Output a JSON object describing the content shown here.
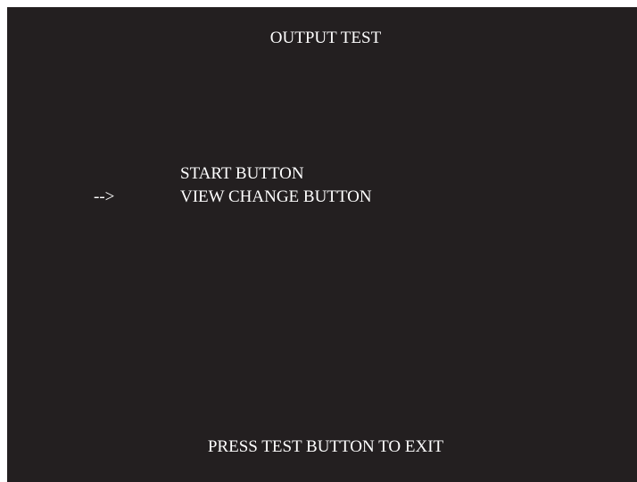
{
  "screen": {
    "title": "OUTPUT TEST",
    "cursor": "-->",
    "menu_items": [
      {
        "label": "START BUTTON",
        "selected": false
      },
      {
        "label": "VIEW CHANGE BUTTON",
        "selected": true
      }
    ],
    "footer": "PRESS TEST BUTTON TO EXIT"
  },
  "colors": {
    "background": "#231f20",
    "text": "#ffffff"
  }
}
